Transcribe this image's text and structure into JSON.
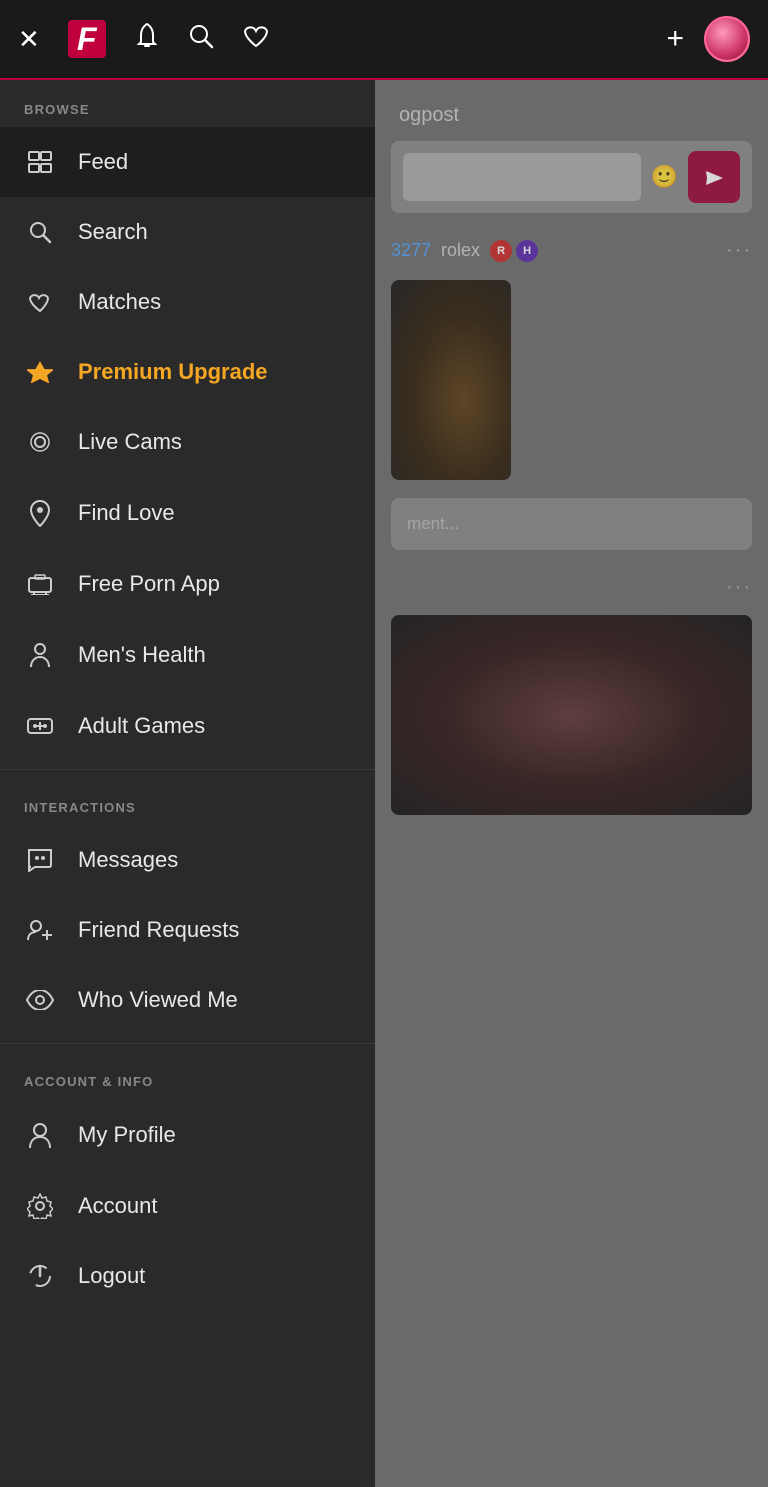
{
  "topbar": {
    "logo_letter": "F",
    "plus_label": "+",
    "icons": {
      "close": "✕",
      "bell": "🔔",
      "search": "🔍",
      "heart": "♥"
    }
  },
  "sidebar": {
    "browse_label": "BROWSE",
    "interactions_label": "INTERACTIONS",
    "account_label": "ACCOUNT & INFO",
    "browse_items": [
      {
        "id": "feed",
        "label": "Feed",
        "icon": "feed",
        "active": true
      },
      {
        "id": "search",
        "label": "Search",
        "icon": "search"
      },
      {
        "id": "matches",
        "label": "Matches",
        "icon": "matches"
      },
      {
        "id": "premium",
        "label": "Premium Upgrade",
        "icon": "premium",
        "premium": true
      },
      {
        "id": "livecams",
        "label": "Live Cams",
        "icon": "livecams"
      },
      {
        "id": "findlove",
        "label": "Find Love",
        "icon": "findlove"
      },
      {
        "id": "freeporn",
        "label": "Free Porn App",
        "icon": "freeporn"
      },
      {
        "id": "menshealth",
        "label": "Men's Health",
        "icon": "menshealth"
      },
      {
        "id": "adultgames",
        "label": "Adult Games",
        "icon": "adultgames"
      }
    ],
    "interaction_items": [
      {
        "id": "messages",
        "label": "Messages",
        "icon": "messages"
      },
      {
        "id": "friendrequests",
        "label": "Friend Requests",
        "icon": "friendrequests"
      },
      {
        "id": "whoviewedme",
        "label": "Who Viewed Me",
        "icon": "whoviewedme"
      }
    ],
    "account_items": [
      {
        "id": "myprofile",
        "label": "My Profile",
        "icon": "myprofile"
      },
      {
        "id": "account",
        "label": "Account",
        "icon": "account"
      },
      {
        "id": "logout",
        "label": "Logout",
        "icon": "logout"
      }
    ]
  },
  "content": {
    "header": "ogpost",
    "post1": {
      "number": "3277",
      "user": "rolex",
      "more": "···",
      "comment_placeholder": "ment..."
    },
    "post2": {
      "more": "···"
    }
  }
}
